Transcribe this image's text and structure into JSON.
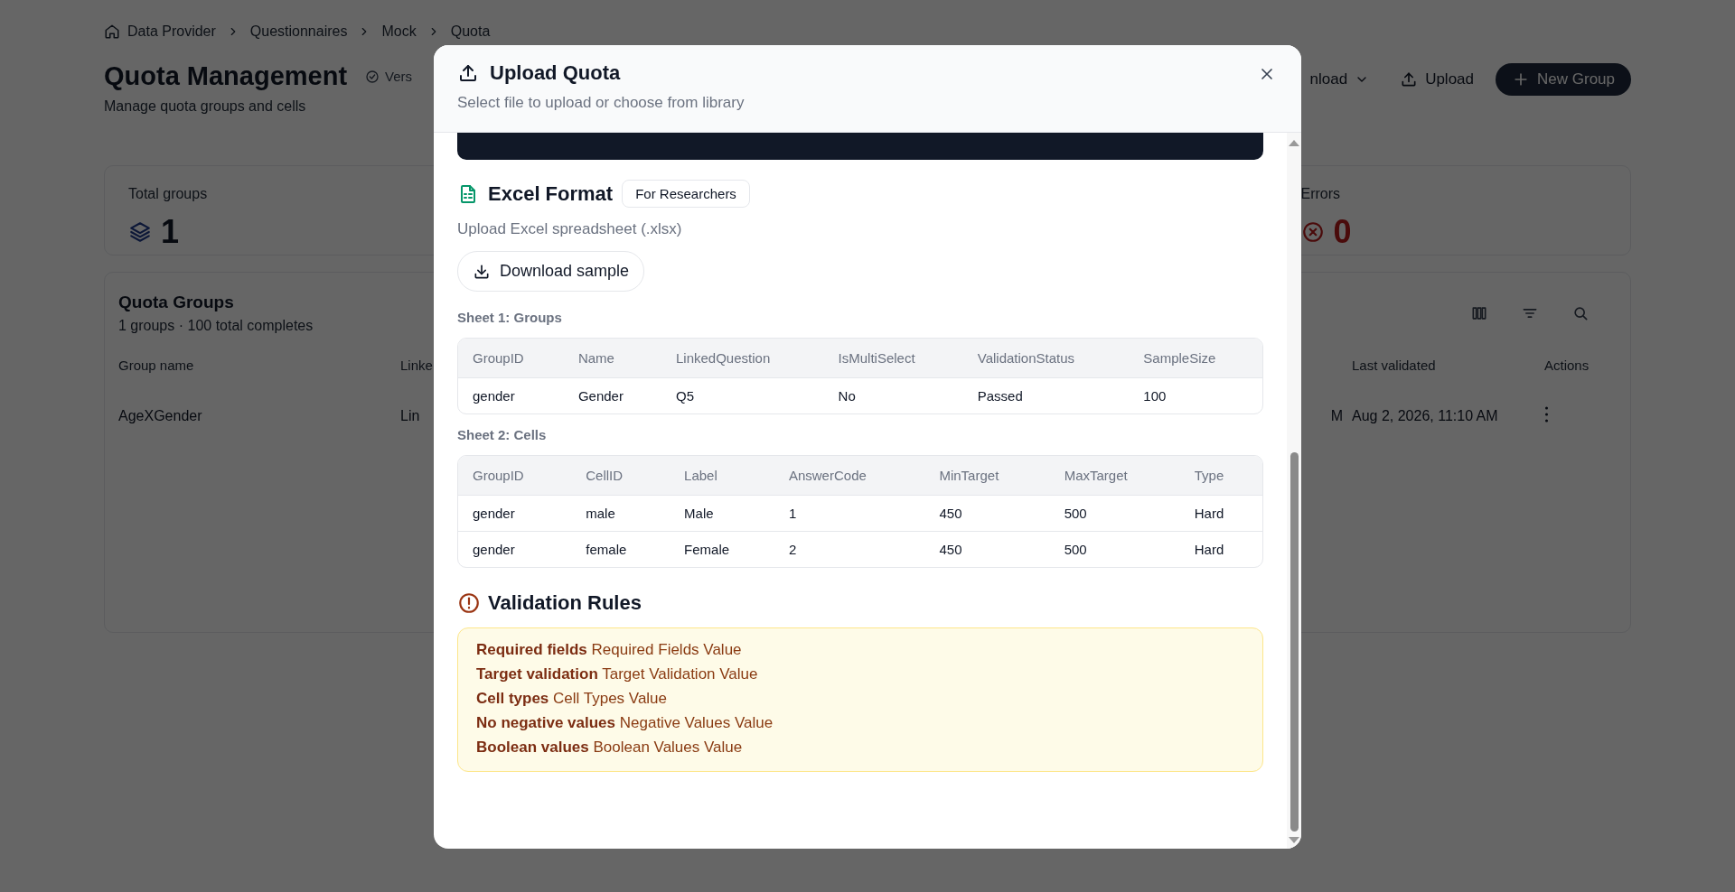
{
  "background": {
    "breadcrumb": [
      "Data Provider",
      "Questionnaires",
      "Mock",
      "Quota"
    ],
    "title": "Quota Management",
    "version_badge": "Vers",
    "subtitle": "Manage quota groups and cells",
    "actions": [
      {
        "kind": "dropdown",
        "label": "nload"
      },
      {
        "kind": "upload",
        "label": "Upload"
      },
      {
        "kind": "primary",
        "label": "New Group"
      }
    ],
    "stats": [
      {
        "kind": "groups",
        "label": "Total groups",
        "value": "1"
      },
      {
        "kind": "errors",
        "label": "Errors",
        "value": "0"
      }
    ],
    "groups_panel": {
      "title": "Quota Groups",
      "summary": "1 groups · 100 total completes",
      "columns": [
        "Group name",
        "Linke",
        "",
        "Last validated",
        "Actions"
      ],
      "rows": [
        {
          "cells": [
            "AgeXGender",
            "Lin",
            "M",
            "Aug 2, 2026, 11:10 AM"
          ]
        }
      ]
    }
  },
  "dialog": {
    "title": "Upload Quota",
    "subtitle": "Select file to upload or choose from library",
    "section": {
      "title": "Excel Format",
      "badge": "For Researchers",
      "description": "Upload Excel spreadsheet (.xlsx)",
      "download_button": "Download sample"
    },
    "sheets": [
      {
        "label": "Sheet 1: Groups",
        "columns": [
          "GroupID",
          "Name",
          "LinkedQuestion",
          "IsMultiSelect",
          "ValidationStatus",
          "SampleSize"
        ],
        "rows": [
          [
            "gender",
            "Gender",
            "Q5",
            "No",
            "Passed",
            "100"
          ]
        ]
      },
      {
        "label": "Sheet 2: Cells",
        "columns": [
          "GroupID",
          "CellID",
          "Label",
          "AnswerCode",
          "MinTarget",
          "MaxTarget",
          "Type"
        ],
        "rows": [
          [
            "gender",
            "male",
            "Male",
            "1",
            "450",
            "500",
            "Hard"
          ],
          [
            "gender",
            "female",
            "Female",
            "2",
            "450",
            "500",
            "Hard"
          ]
        ]
      }
    ],
    "rules_title": "Validation Rules",
    "rules": [
      "**Required fields** Required Fields Value",
      "**Target validation** Target Validation Value",
      "**Cell types** Cell Types Value",
      "**No negative values** Negative Values Value",
      "**Boolean values** Boolean Values Value"
    ]
  }
}
